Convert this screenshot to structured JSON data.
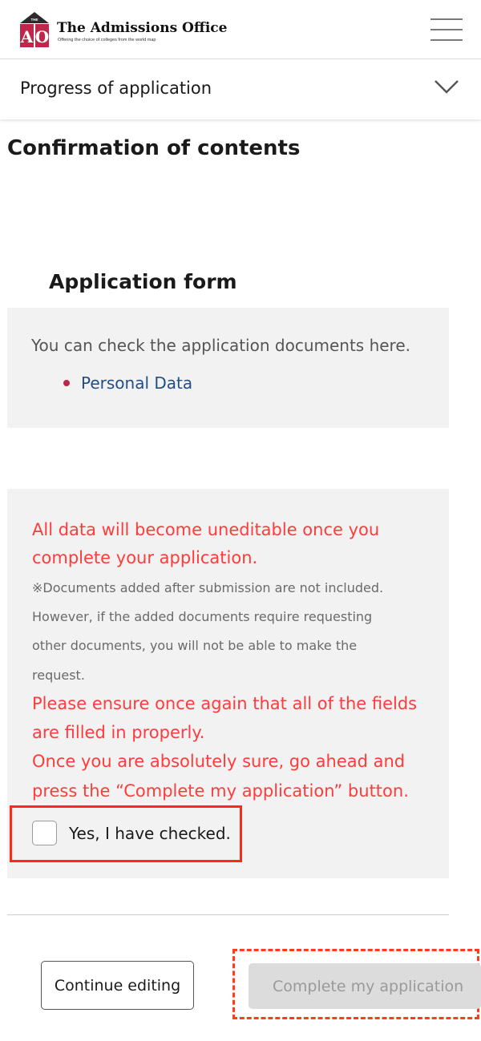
{
  "header": {
    "logo_text": "THE A O",
    "brand_title": "The Admissions Office",
    "brand_subtitle": "Offering the choice of colleges from the world map",
    "menu_icon": "hamburger-menu-icon"
  },
  "progress": {
    "label": "Progress of application",
    "icon": "chevron-down-icon"
  },
  "main": {
    "page_title": "Confirmation of contents",
    "section_title": "Application form",
    "documents": {
      "intro": "You can check the application documents here.",
      "items": [
        {
          "label": "Personal Data"
        }
      ]
    },
    "notice": {
      "warning_line1": "All data will become uneditable once you",
      "warning_line2": "complete your application.",
      "note_line1": "※Documents added after submission are not included.",
      "note_line2": "However, if the added documents require requesting",
      "note_line3": "other documents, you will not be able to make the",
      "note_line4": "request.",
      "ensure_line1": "Please ensure once again that all of the fields",
      "ensure_line2": "are filled in properly.",
      "ensure_line3": "Once you are absolutely sure, go ahead and",
      "ensure_line4": "press the “Complete my application” button.",
      "checkbox_label": "Yes, I have checked.",
      "checkbox_checked": false
    },
    "actions": {
      "continue_label": "Continue editing",
      "complete_label": "Complete my application",
      "complete_enabled": false
    }
  },
  "colors": {
    "brand_red": "#c0254a",
    "warning_red": "#ff3b3b",
    "link_blue": "#1f4f86",
    "panel_gray": "#f2f2f2"
  }
}
